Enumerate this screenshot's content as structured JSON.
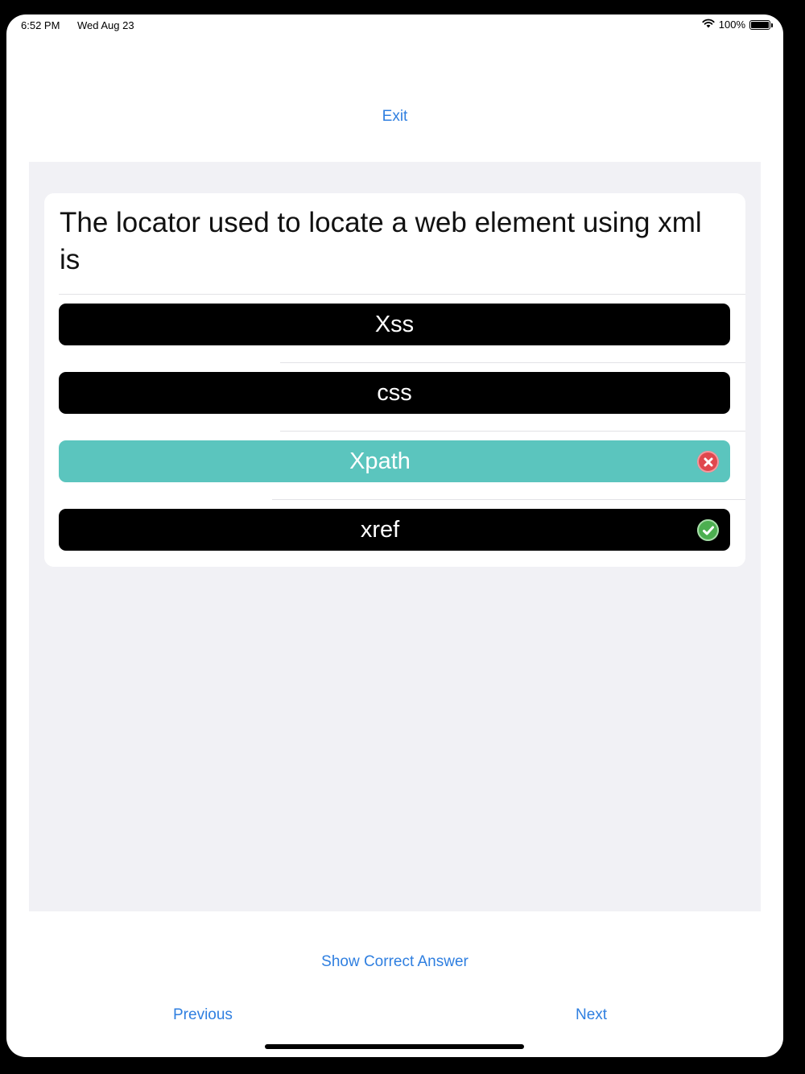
{
  "status_bar": {
    "time": "6:52 PM",
    "date": "Wed Aug 23",
    "battery": "100%",
    "wifi_icon": "wifi-icon",
    "battery_icon": "battery-icon"
  },
  "header": {
    "exit_label": "Exit"
  },
  "quiz": {
    "question": "The locator used to locate a web element using xml is",
    "options": [
      {
        "label": "Xss",
        "state": "default"
      },
      {
        "label": "css",
        "state": "default"
      },
      {
        "label": "Xpath",
        "state": "selected-wrong",
        "icon": "x-circle-icon"
      },
      {
        "label": "xref",
        "state": "correct",
        "icon": "checkmark-circle-icon"
      }
    ],
    "colors": {
      "option_bg": "#000000",
      "selected_bg": "#5bc5be",
      "wrong_badge": "#e0484e",
      "correct_badge": "#4caf50",
      "link": "#2f7fe0"
    }
  },
  "footer": {
    "show_answer_label": "Show Correct Answer",
    "previous_label": "Previous",
    "next_label": "Next"
  }
}
